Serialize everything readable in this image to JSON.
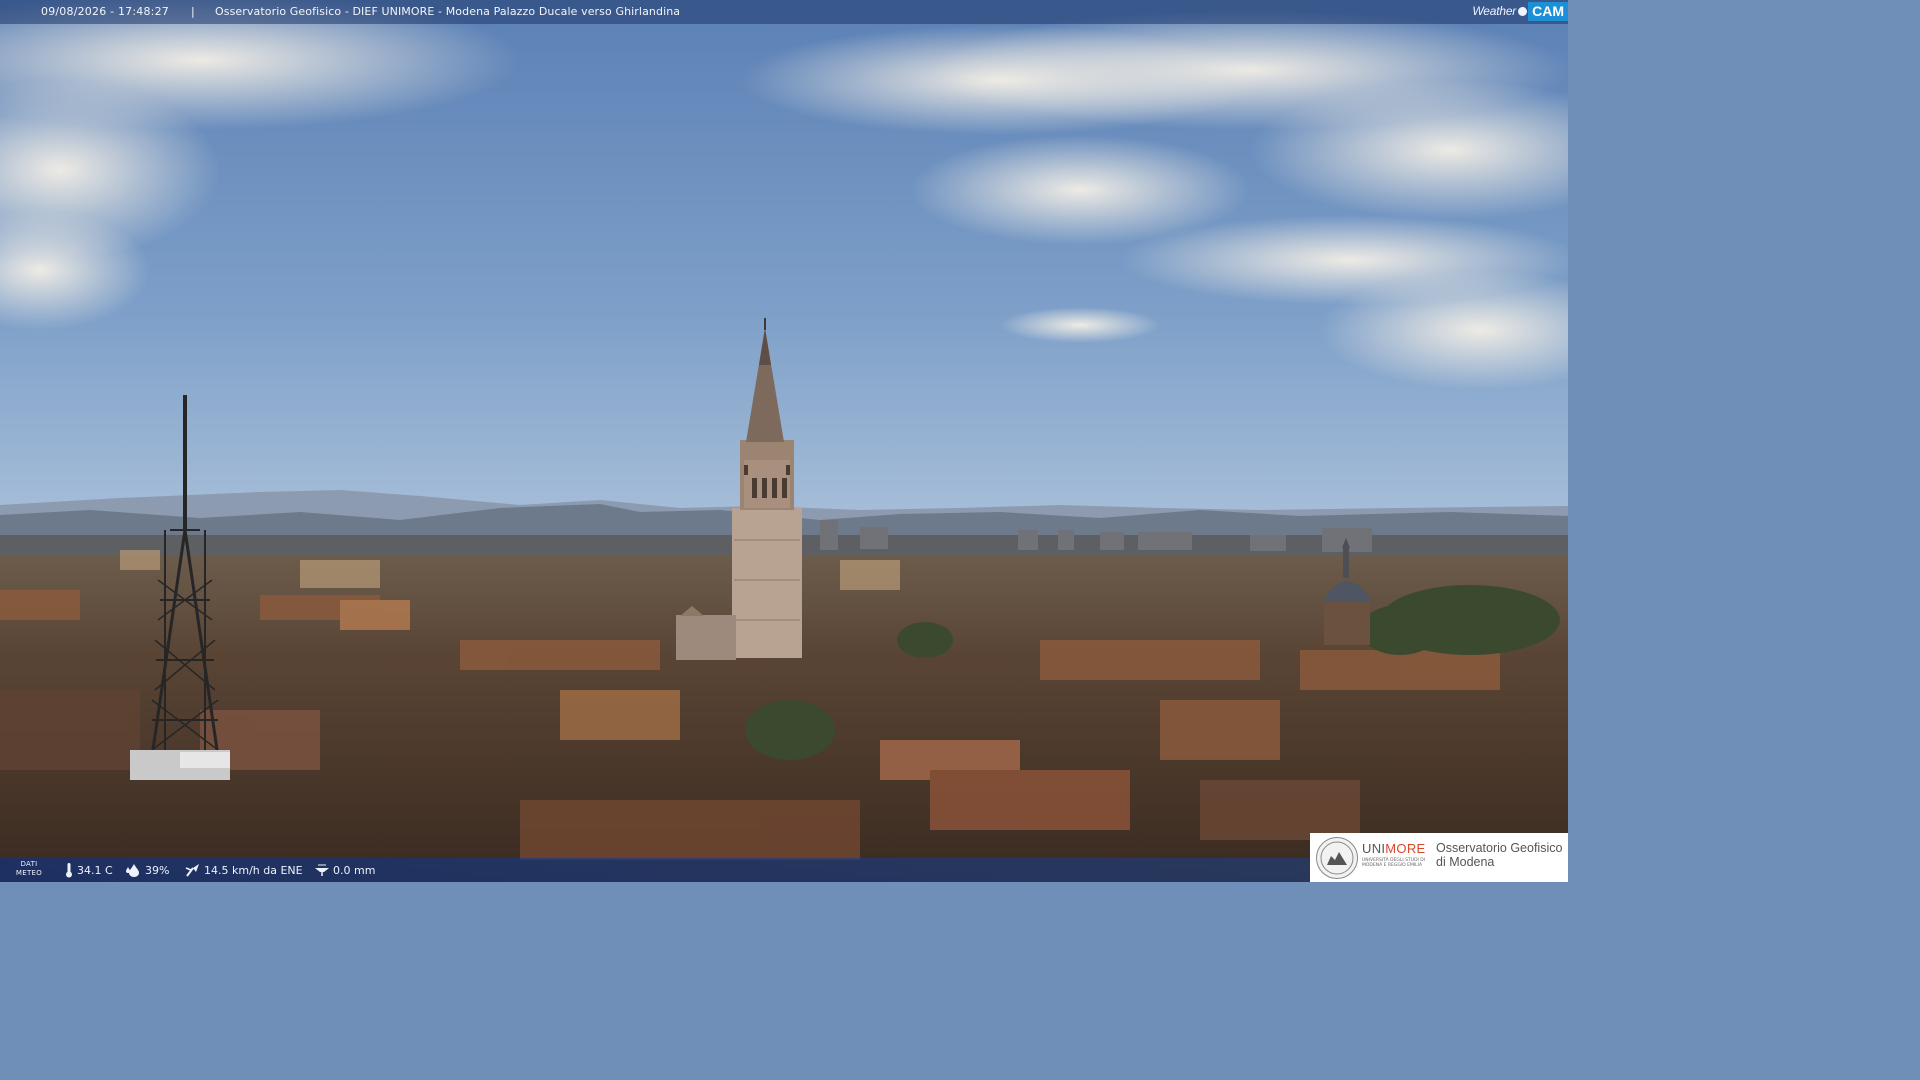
{
  "header": {
    "timestamp": "09/08/2026 - 17:48:27",
    "separator": "|",
    "title": "Osservatorio Geofisico - DIEF UNIMORE - Modena Palazzo Ducale verso Ghirlandina"
  },
  "brand": {
    "weather": "Weather",
    "cam": "CAM"
  },
  "meteo": {
    "label_line1": "DATI",
    "label_line2": "METEO",
    "temperature": "34.1 C",
    "humidity": "39%",
    "wind": "14.5 km/h da ENE",
    "rain": "0.0 mm"
  },
  "logo": {
    "uni_a": "UNI",
    "uni_b": "MORE",
    "uni_small": "UNIVERSITÀ DEGLI STUDI DI MODENA E REGGIO EMILIA",
    "obs_line1": "Osservatorio Geofisico",
    "obs_line2": "di Modena"
  },
  "colors": {
    "bar": "#1e3769",
    "brand_blue": "#1c8fd6",
    "unimore_red": "#d9472b"
  }
}
